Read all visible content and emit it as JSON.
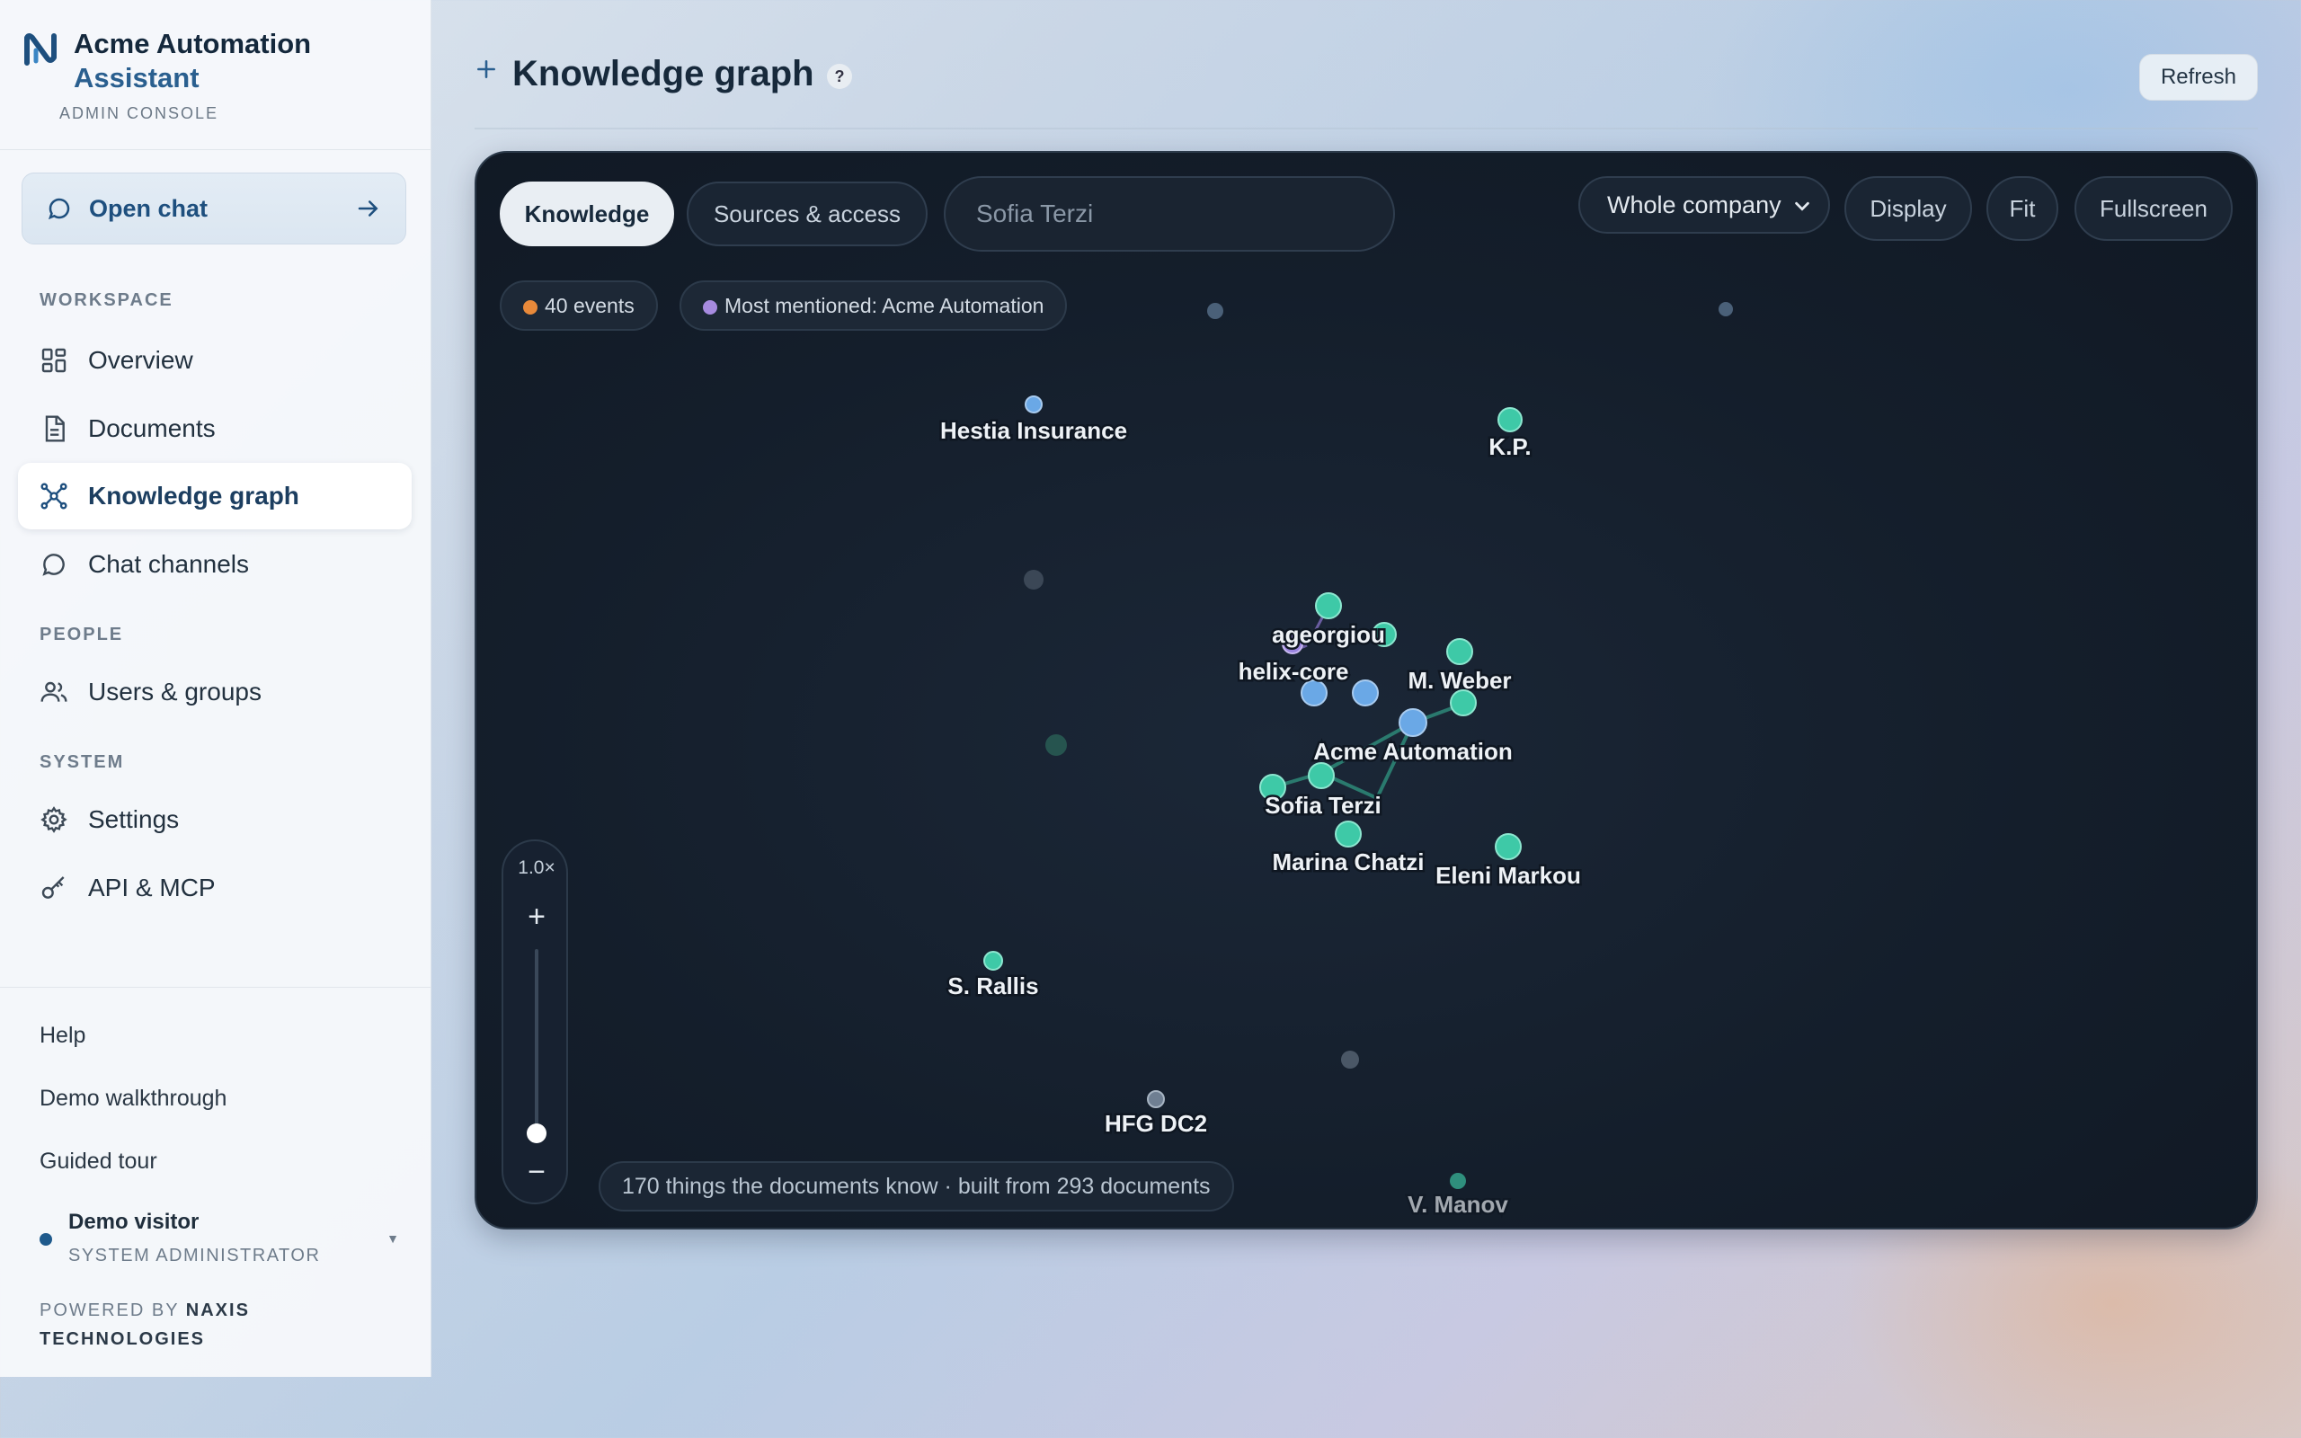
{
  "brand": {
    "name_line1": "Acme Automation",
    "name_line2": "Assistant",
    "subtitle": "ADMIN CONSOLE"
  },
  "open_chat": {
    "label": "Open chat"
  },
  "sidebar": {
    "sections": [
      {
        "label": "WORKSPACE"
      },
      {
        "label": "PEOPLE"
      },
      {
        "label": "SYSTEM"
      }
    ],
    "items": [
      {
        "label": "Overview",
        "icon": "grid-icon"
      },
      {
        "label": "Documents",
        "icon": "document-icon"
      },
      {
        "label": "Knowledge graph",
        "icon": "graph-icon",
        "active": true
      },
      {
        "label": "Chat channels",
        "icon": "chat-icon"
      },
      {
        "label": "Users & groups",
        "icon": "users-icon"
      },
      {
        "label": "Settings",
        "icon": "gear-icon"
      },
      {
        "label": "API & MCP",
        "icon": "key-icon"
      }
    ],
    "bottom_links": [
      "Help",
      "Demo walkthrough",
      "Guided tour"
    ],
    "user": {
      "name": "Demo visitor",
      "role": "SYSTEM ADMINISTRATOR"
    },
    "powered_by": {
      "prefix": "POWERED BY",
      "company": "NAXIS TECHNOLOGIES"
    }
  },
  "header": {
    "title": "Knowledge graph",
    "help": "?",
    "refresh_label": "Refresh"
  },
  "graph_toolbar": {
    "tabs": [
      {
        "label": "Knowledge",
        "active": true
      },
      {
        "label": "Sources & access",
        "active": false
      }
    ],
    "search_placeholder": "Sofia Terzi",
    "scope_select": "Whole company",
    "display_label": "Display",
    "fit_label": "Fit",
    "fullscreen_label": "Fullscreen"
  },
  "chips": {
    "events": {
      "label": "40 events",
      "color": "#e8893a"
    },
    "most_mentioned": {
      "label": "Most mentioned: Acme Automation",
      "color": "#a78be0"
    }
  },
  "zoom": {
    "level": "1.0×",
    "plus": "+",
    "minus": "−",
    "value": 0.1
  },
  "footer": {
    "summary": "170 things the documents know · built from 293 documents"
  },
  "colors": {
    "person": "#3ec9a7",
    "organization": "#6aa8e6",
    "topic": "#9b84e0",
    "muted": "#4a5a6b",
    "accent": "#1e4f7e"
  },
  "graph": {
    "labels": [
      "Hestia Insurance",
      "K.P.",
      "ageorgiou",
      "helix-core",
      "M. Weber",
      "Acme Automation",
      "Sofia Terzi",
      "Marina Chatzi",
      "Eleni Markou",
      "S. Rallis",
      "HFG DC2",
      "V. Manov"
    ]
  }
}
